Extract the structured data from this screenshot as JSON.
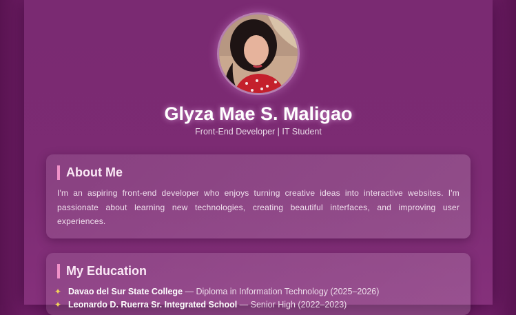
{
  "profile": {
    "name": "Glyza Mae S. Maligao",
    "subtitle": "Front-End Developer | IT Student"
  },
  "about": {
    "heading": "About Me",
    "text": "I'm an aspiring front-end developer who enjoys turning creative ideas into interactive websites. I'm passionate about learning new technologies, creating beautiful interfaces, and improving user experiences."
  },
  "education": {
    "heading": "My Education",
    "items": [
      {
        "icon": "graduation-sparkle-icon",
        "school": "Davao del Sur State College",
        "detail": " — Diploma in Information Technology (2025–2026)"
      },
      {
        "icon": "graduation-sparkle-icon",
        "school": "Leonardo D. Ruerra Sr. Integrated School",
        "detail": " — Senior High (2022–2023)"
      }
    ]
  },
  "colors": {
    "background": "#76236d",
    "accent_bar": "#f092c8",
    "avatar_ring": "#b57fb0"
  }
}
